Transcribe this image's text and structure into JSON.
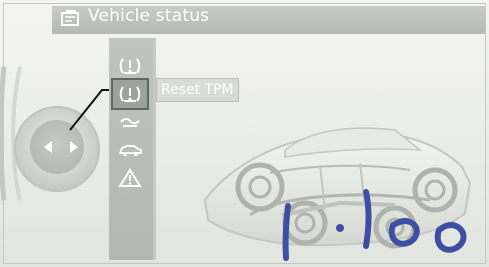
{
  "header": {
    "title": "Vehicle status",
    "icon": "document-icon"
  },
  "menu": {
    "items": [
      {
        "icon": "tire-pressure-icon",
        "selected": false
      },
      {
        "icon": "tire-pressure-icon",
        "selected": true
      },
      {
        "icon": "oil-level-icon",
        "selected": false
      },
      {
        "icon": "car-icon",
        "selected": false
      },
      {
        "icon": "warning-triangle-icon",
        "selected": false
      }
    ]
  },
  "callout": {
    "label": "Reset TPM"
  },
  "colors": {
    "header": "#b9bdb6",
    "callout_text": "#ffffff",
    "watermark": "#3e4fa3"
  }
}
